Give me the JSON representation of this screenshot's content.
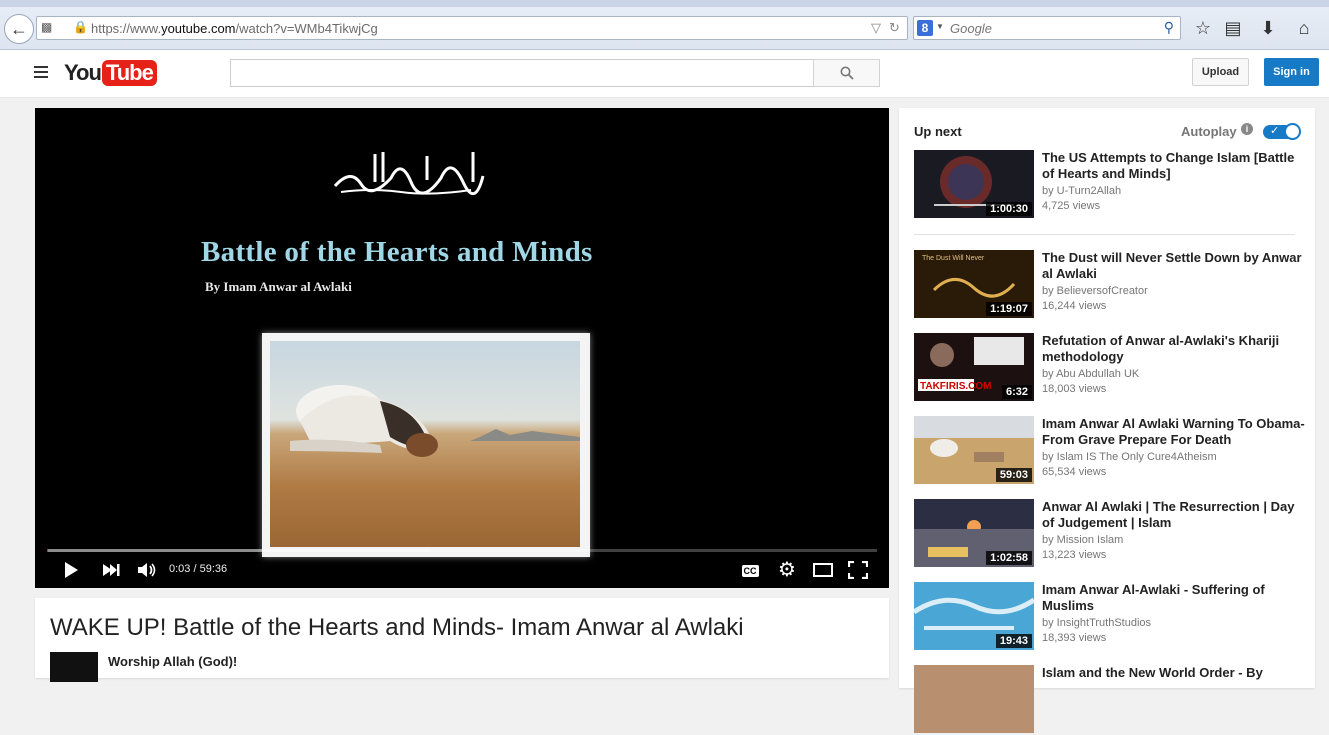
{
  "browser": {
    "url_prefix": "https://www.",
    "url_domain": "youtube.com",
    "url_path": "/watch?v=WMb4TikwjCg",
    "search_engine_letter": "8",
    "search_placeholder": "Google"
  },
  "masthead": {
    "logo_you": "You",
    "logo_tube": "Tube",
    "upload_label": "Upload",
    "signin_label": "Sign in"
  },
  "player": {
    "overlay_title": "Battle of the Hearts and Minds",
    "overlay_byline": "By Imam Anwar al Awlaki",
    "time_display": "0:03 / 59:36",
    "cc_label": "CC",
    "progress_played_fraction": 0.001,
    "progress_buffered_fraction": 0.46
  },
  "watch": {
    "title": "WAKE UP! Battle of the Hearts and Minds- Imam Anwar al Awlaki",
    "channel": "Worship Allah (God)!"
  },
  "sidebar": {
    "up_next_label": "Up next",
    "autoplay_label": "Autoplay",
    "autoplay_on": true,
    "videos": [
      {
        "title": "The US Attempts to Change Islam [Battle of Hearts and Minds]",
        "channel": "by U-Turn2Allah",
        "views": "4,725 views",
        "duration": "1:00:30",
        "thumb_color": "#1a1a22"
      },
      {
        "title": "The Dust will Never Settle Down by Anwar al Awlaki",
        "channel": "by BelieversofCreator",
        "views": "16,244 views",
        "duration": "1:19:07",
        "thumb_color": "#2a1a08"
      },
      {
        "title": "Refutation of Anwar al-Awlaki's Khariji methodology",
        "channel": "by Abu Abdullah UK",
        "views": "18,003 views",
        "duration": "6:32",
        "thumb_color": "#1c1010"
      },
      {
        "title": "Imam Anwar Al Awlaki Warning To Obama- From Grave Prepare For Death",
        "channel": "by Islam IS The Only Cure4Atheism",
        "views": "65,534 views",
        "duration": "59:03",
        "thumb_color": "#c9a46c"
      },
      {
        "title": "Anwar Al Awlaki | The Resurrection | Day of Judgement | Islam",
        "channel": "by Mission Islam",
        "views": "13,223 views",
        "duration": "1:02:58",
        "thumb_color": "#3a3c4e"
      },
      {
        "title": "Imam Anwar Al-Awlaki - Suffering of Muslims",
        "channel": "by InsightTruthStudios",
        "views": "18,393 views",
        "duration": "19:43",
        "thumb_color": "#4aa6d4"
      },
      {
        "title": "Islam and the New World Order - By",
        "channel": "",
        "views": "",
        "duration": "",
        "thumb_color": "#b89070"
      }
    ]
  }
}
